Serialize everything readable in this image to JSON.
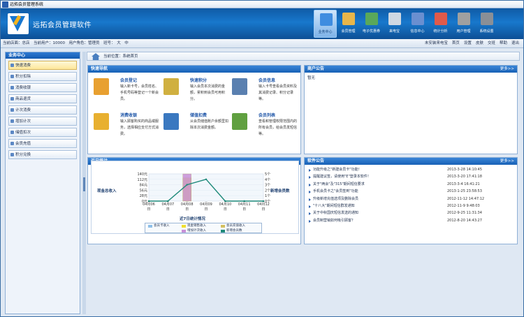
{
  "window": {
    "title": "远拓会员管理系统"
  },
  "header": {
    "app_title": "远拓会员管理软件",
    "nav": [
      {
        "label": "业务中心",
        "icon": "business-icon",
        "active": true,
        "color": "#3f8de0"
      },
      {
        "label": "会员管理",
        "icon": "members-icon",
        "color": "#e8b64a"
      },
      {
        "label": "电子优惠券",
        "icon": "coupon-icon",
        "color": "#5aa85a"
      },
      {
        "label": "来电宝",
        "icon": "phone-icon",
        "color": "#cfd8e2"
      },
      {
        "label": "信息中心",
        "icon": "message-icon",
        "color": "#6a8fd0"
      },
      {
        "label": "统计分析",
        "icon": "stats-icon",
        "color": "#e05a4a"
      },
      {
        "label": "用户管理",
        "icon": "users-icon",
        "color": "#a0a0a0"
      },
      {
        "label": "系统设置",
        "icon": "settings-icon",
        "color": "#8a8f96"
      }
    ]
  },
  "status": {
    "text": "当前店面：总店　当前用户：10000　用户角色：管理员　班号：　大　中",
    "links": [
      "未安装来电宝",
      "首页",
      "设置",
      "皮肤",
      "交班",
      "帮助",
      "退出"
    ]
  },
  "sidebar": {
    "title": "业务中心",
    "items": [
      "快速消费",
      "积分扣除",
      "消费收银",
      "商品退货",
      "计次消费",
      "增加计次",
      "储值扣次",
      "会员充值",
      "积分兑换"
    ]
  },
  "breadcrumb": "当前位置：系统首页",
  "quick": {
    "title": "快速导航",
    "items": [
      {
        "title": "会员登记",
        "desc": "输入新卡号，会员姓名、手机号码等登记一个新会员。",
        "color": "#e8a030"
      },
      {
        "title": "快速积分",
        "desc": "输入会员本次消费的金额，累积到会员可用积分。",
        "color": "#d0b040"
      },
      {
        "title": "会员信息",
        "desc": "输入卡号查看会员资料及其消费记录、积分记录等。",
        "color": "#5a80b0"
      },
      {
        "title": "消费收银",
        "desc": "输入顾客购买的商品或服务，选择相应支付方式消费。",
        "color": "#e8b030"
      },
      {
        "title": "储值扣费",
        "desc": "从会员储值账户余额里扣除本次消费金额。",
        "color": "#3a78c0"
      },
      {
        "title": "会员列表",
        "desc": "查看和管理权限范围内的所有会员，给会员发短信等。",
        "color": "#60a040"
      }
    ]
  },
  "announce": {
    "title": "商户公告",
    "more": "更多>>",
    "text": "暂无"
  },
  "stats": {
    "title": "近日统计",
    "left_label": "现金总收入",
    "right_label": "新增会员数",
    "chart_title": "近7日统计情况"
  },
  "chart_data": {
    "type": "line",
    "x": [
      "04月06日",
      "04月07日",
      "04月08日",
      "04月09日",
      "04月10日",
      "04月11日",
      "04月12日"
    ],
    "y_left_ticks": [
      "140元",
      "112元",
      "84元",
      "56元",
      "28元",
      "0元"
    ],
    "y_right_ticks": [
      "5个",
      "4个",
      "3个",
      "2个",
      "1个",
      "0个"
    ],
    "series": [
      {
        "name": "会员卡收入",
        "color": "#8fc0e8",
        "values": [
          0,
          0,
          0,
          0,
          0,
          0,
          0
        ]
      },
      {
        "name": "现金销售收入",
        "color": "#f0e030",
        "values": [
          0,
          0,
          120,
          0,
          0,
          0,
          0
        ]
      },
      {
        "name": "会员充值收入",
        "color": "#d4c060",
        "values": [
          0,
          0,
          0,
          0,
          0,
          0,
          0
        ]
      },
      {
        "name": "增加计次收入",
        "color": "#c890d8",
        "values": [
          0,
          0,
          140,
          0,
          0,
          0,
          0
        ]
      },
      {
        "name": "新增会员数",
        "color": "#1f8a7a",
        "values": [
          0,
          0,
          3,
          4,
          0,
          0,
          0
        ]
      }
    ]
  },
  "software": {
    "title": "软件公告",
    "more": "更多>>",
    "items": [
      {
        "t": "功能升级之\"新建会员卡\"功能！",
        "d": "2013-3-28 14:10:45"
      },
      {
        "t": "提醒建议签，请使用\"E\"登录本软件！",
        "d": "2013-3-20 17:41:18"
      },
      {
        "t": "关于\"两会\"及\"315\"期间短信要求",
        "d": "2013-3-4 16:41:21"
      },
      {
        "t": "手机会员卡之\"会员签到\"功能",
        "d": "2013-1-25 23:58:53"
      },
      {
        "t": "升级新增充值选项及删除会员",
        "d": "2012-11-12 14:47:12"
      },
      {
        "t": "\"十八大\"期间短信群发通知",
        "d": "2012-11-9 9:48:03"
      },
      {
        "t": "关于中秋国庆短信发送的通知",
        "d": "2012-9-25 11:31:34"
      },
      {
        "t": "会员制营销如何吸引顾客？",
        "d": "2012-8-20 14:43:27"
      }
    ]
  }
}
